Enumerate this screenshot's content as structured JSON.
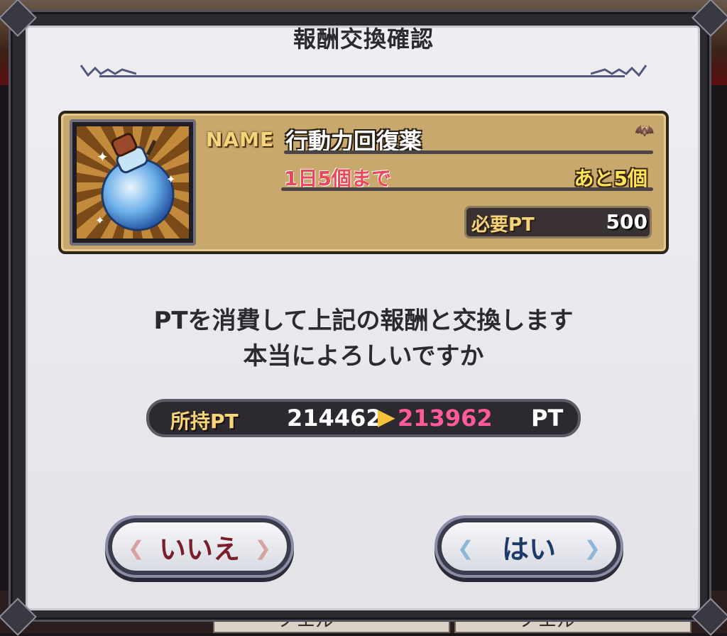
{
  "dialog": {
    "title": "報酬交換確認"
  },
  "item": {
    "name_tag": "NAME",
    "name": "行動力回復薬",
    "limit": "1日5個まで",
    "remaining": "あと5個",
    "required_label": "必要PT",
    "required_value": "500",
    "icon": "potion-icon"
  },
  "message": {
    "line1": "PTを消費して上記の報酬と交換します",
    "line2": "本当によろしいですか"
  },
  "points": {
    "label": "所持PT",
    "current": "214462",
    "after": "213962",
    "unit": "PT"
  },
  "buttons": {
    "no": "いいえ",
    "yes": "はい"
  },
  "background": {
    "strip1": "ノエル",
    "strip2": "ノエル"
  },
  "colors": {
    "limit_red": "#e8485a",
    "remaining_yellow": "#ffe35a",
    "after_pink": "#ff5a9a",
    "label_gold": "#f6d47a"
  }
}
